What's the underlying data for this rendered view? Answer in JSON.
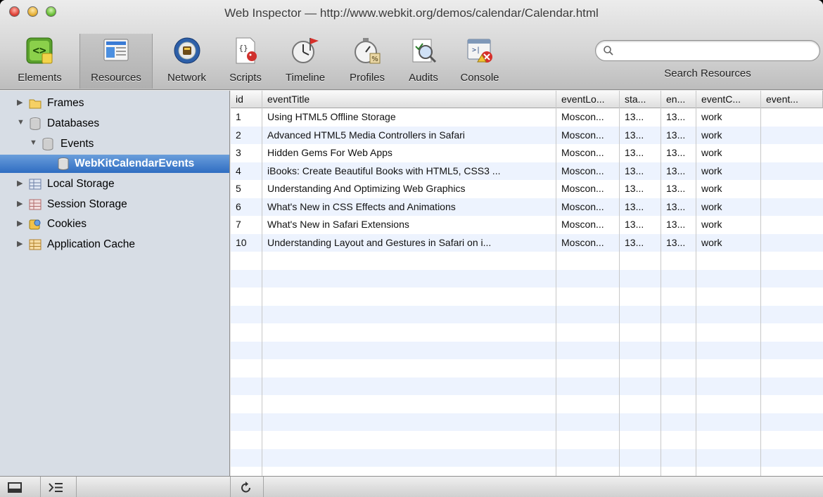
{
  "window": {
    "title": "Web Inspector — http://www.webkit.org/demos/calendar/Calendar.html"
  },
  "toolbar": {
    "tools": [
      {
        "label": "Elements",
        "icon": "elements-icon"
      },
      {
        "label": "Resources",
        "icon": "resources-icon",
        "selected": true
      },
      {
        "label": "Network",
        "icon": "network-icon"
      },
      {
        "label": "Scripts",
        "icon": "scripts-icon"
      },
      {
        "label": "Timeline",
        "icon": "timeline-icon"
      },
      {
        "label": "Profiles",
        "icon": "profiles-icon"
      },
      {
        "label": "Audits",
        "icon": "audits-icon"
      },
      {
        "label": "Console",
        "icon": "console-icon"
      }
    ],
    "search": {
      "placeholder": "",
      "value": "",
      "label": "Search Resources"
    }
  },
  "sidebar": {
    "items": [
      {
        "label": "Frames",
        "icon": "folder-icon",
        "expanded": false
      },
      {
        "label": "Databases",
        "icon": "database-icon",
        "expanded": true
      },
      {
        "label": "Events",
        "icon": "database-icon",
        "expanded": true
      },
      {
        "label": "WebKitCalendarEvents",
        "icon": "table-icon",
        "selected": true
      },
      {
        "label": "Local Storage",
        "icon": "local-storage-icon",
        "expanded": false
      },
      {
        "label": "Session Storage",
        "icon": "session-storage-icon",
        "expanded": false
      },
      {
        "label": "Cookies",
        "icon": "cookies-icon",
        "expanded": false
      },
      {
        "label": "Application Cache",
        "icon": "app-cache-icon",
        "expanded": false
      }
    ]
  },
  "grid": {
    "columns": [
      "id",
      "eventTitle",
      "eventLo...",
      "sta...",
      "en...",
      "eventC...",
      "event..."
    ],
    "rows": [
      [
        "1",
        "Using HTML5 Offline Storage",
        "Moscon...",
        "13...",
        "13...",
        "work",
        ""
      ],
      [
        "2",
        "Advanced HTML5 Media Controllers in Safari",
        "Moscon...",
        "13...",
        "13...",
        "work",
        ""
      ],
      [
        "3",
        "Hidden Gems For Web Apps",
        "Moscon...",
        "13...",
        "13...",
        "work",
        ""
      ],
      [
        "4",
        "iBooks: Create Beautiful Books with HTML5, CSS3 ...",
        "Moscon...",
        "13...",
        "13...",
        "work",
        ""
      ],
      [
        "5",
        "Understanding And Optimizing Web Graphics",
        "Moscon...",
        "13...",
        "13...",
        "work",
        ""
      ],
      [
        "6",
        "What's New in CSS Effects and Animations",
        "Moscon...",
        "13...",
        "13...",
        "work",
        ""
      ],
      [
        "7",
        "What's New in Safari Extensions",
        "Moscon...",
        "13...",
        "13...",
        "work",
        ""
      ],
      [
        "10",
        "Understanding Layout and Gestures in Safari on i...",
        "Moscon...",
        "13...",
        "13...",
        "work",
        ""
      ]
    ]
  },
  "statusbar": {
    "buttons": [
      {
        "icon": "dock-icon"
      },
      {
        "icon": "console-toggle-icon"
      },
      {
        "icon": "refresh-icon"
      }
    ]
  },
  "colors": {
    "selection": "#2f6dc2",
    "sidebar_bg": "#d7dde5",
    "stripe": "#edf3fe"
  }
}
